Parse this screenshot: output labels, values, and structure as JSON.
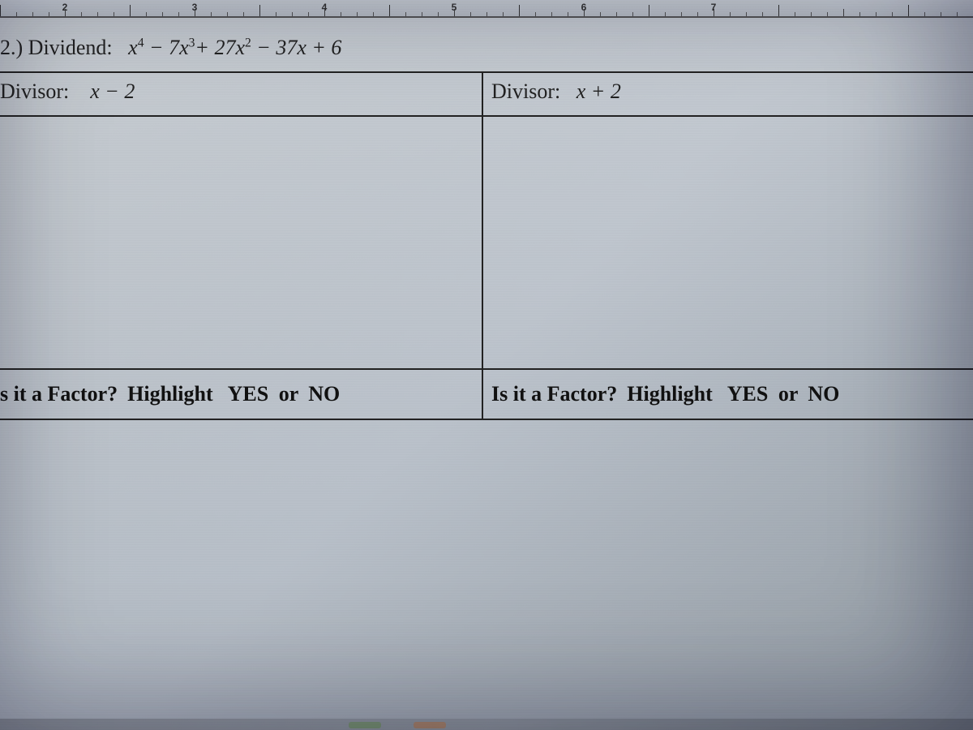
{
  "ruler": {
    "numbers": [
      "2",
      "3",
      "4",
      "5",
      "6",
      "7"
    ]
  },
  "problem": {
    "number": "2.)",
    "dividend_label": "Dividend:",
    "dividend_poly_prefix": "x",
    "dividend_poly_text_parts": {
      "a": " − 7",
      "b": "+ 27",
      "c": " − 37",
      "d": " + 6"
    }
  },
  "left": {
    "divisor_label": "Divisor:",
    "divisor_expr": "x − 2",
    "factor_question": "s it a Factor?",
    "highlight_word": "Highlight",
    "yes": "YES",
    "or": "or",
    "no": "NO"
  },
  "right": {
    "divisor_label": "Divisor:",
    "divisor_expr": "x + 2",
    "factor_question": "Is it a Factor?",
    "highlight_word": "Highlight",
    "yes": "YES",
    "or": "or",
    "no": "NO"
  }
}
